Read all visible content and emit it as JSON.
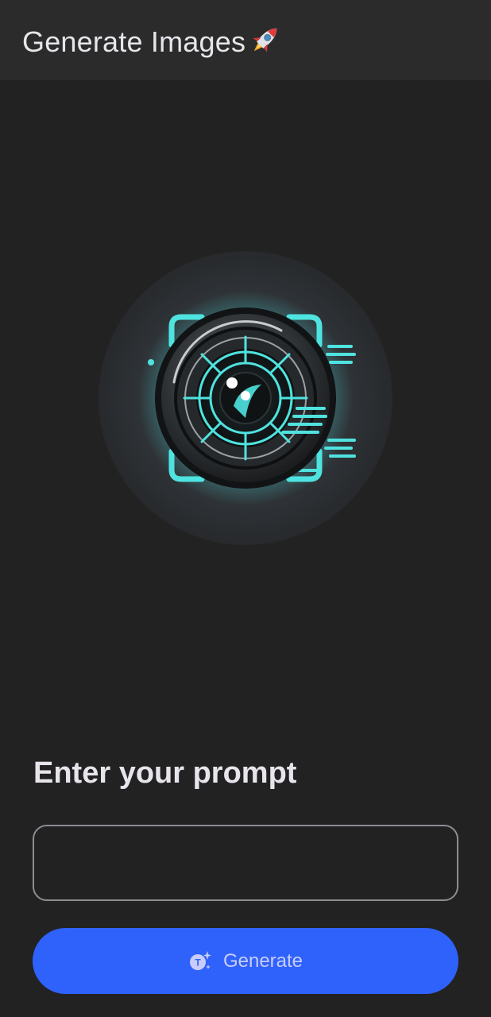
{
  "app_bar": {
    "title": "Generate Images",
    "title_icon": "rocket-icon"
  },
  "hero": {
    "image": "camera-lens-logo"
  },
  "prompt": {
    "heading": "Enter your prompt",
    "value": "",
    "placeholder": ""
  },
  "generate_button": {
    "label": "Generate",
    "icon": "ai-text-sparkle-icon"
  },
  "colors": {
    "background": "#222222",
    "app_bar": "#2b2b2c",
    "accent": "#2f62fb",
    "glow": "#49e6e6",
    "input_border": "#8e8c93"
  }
}
